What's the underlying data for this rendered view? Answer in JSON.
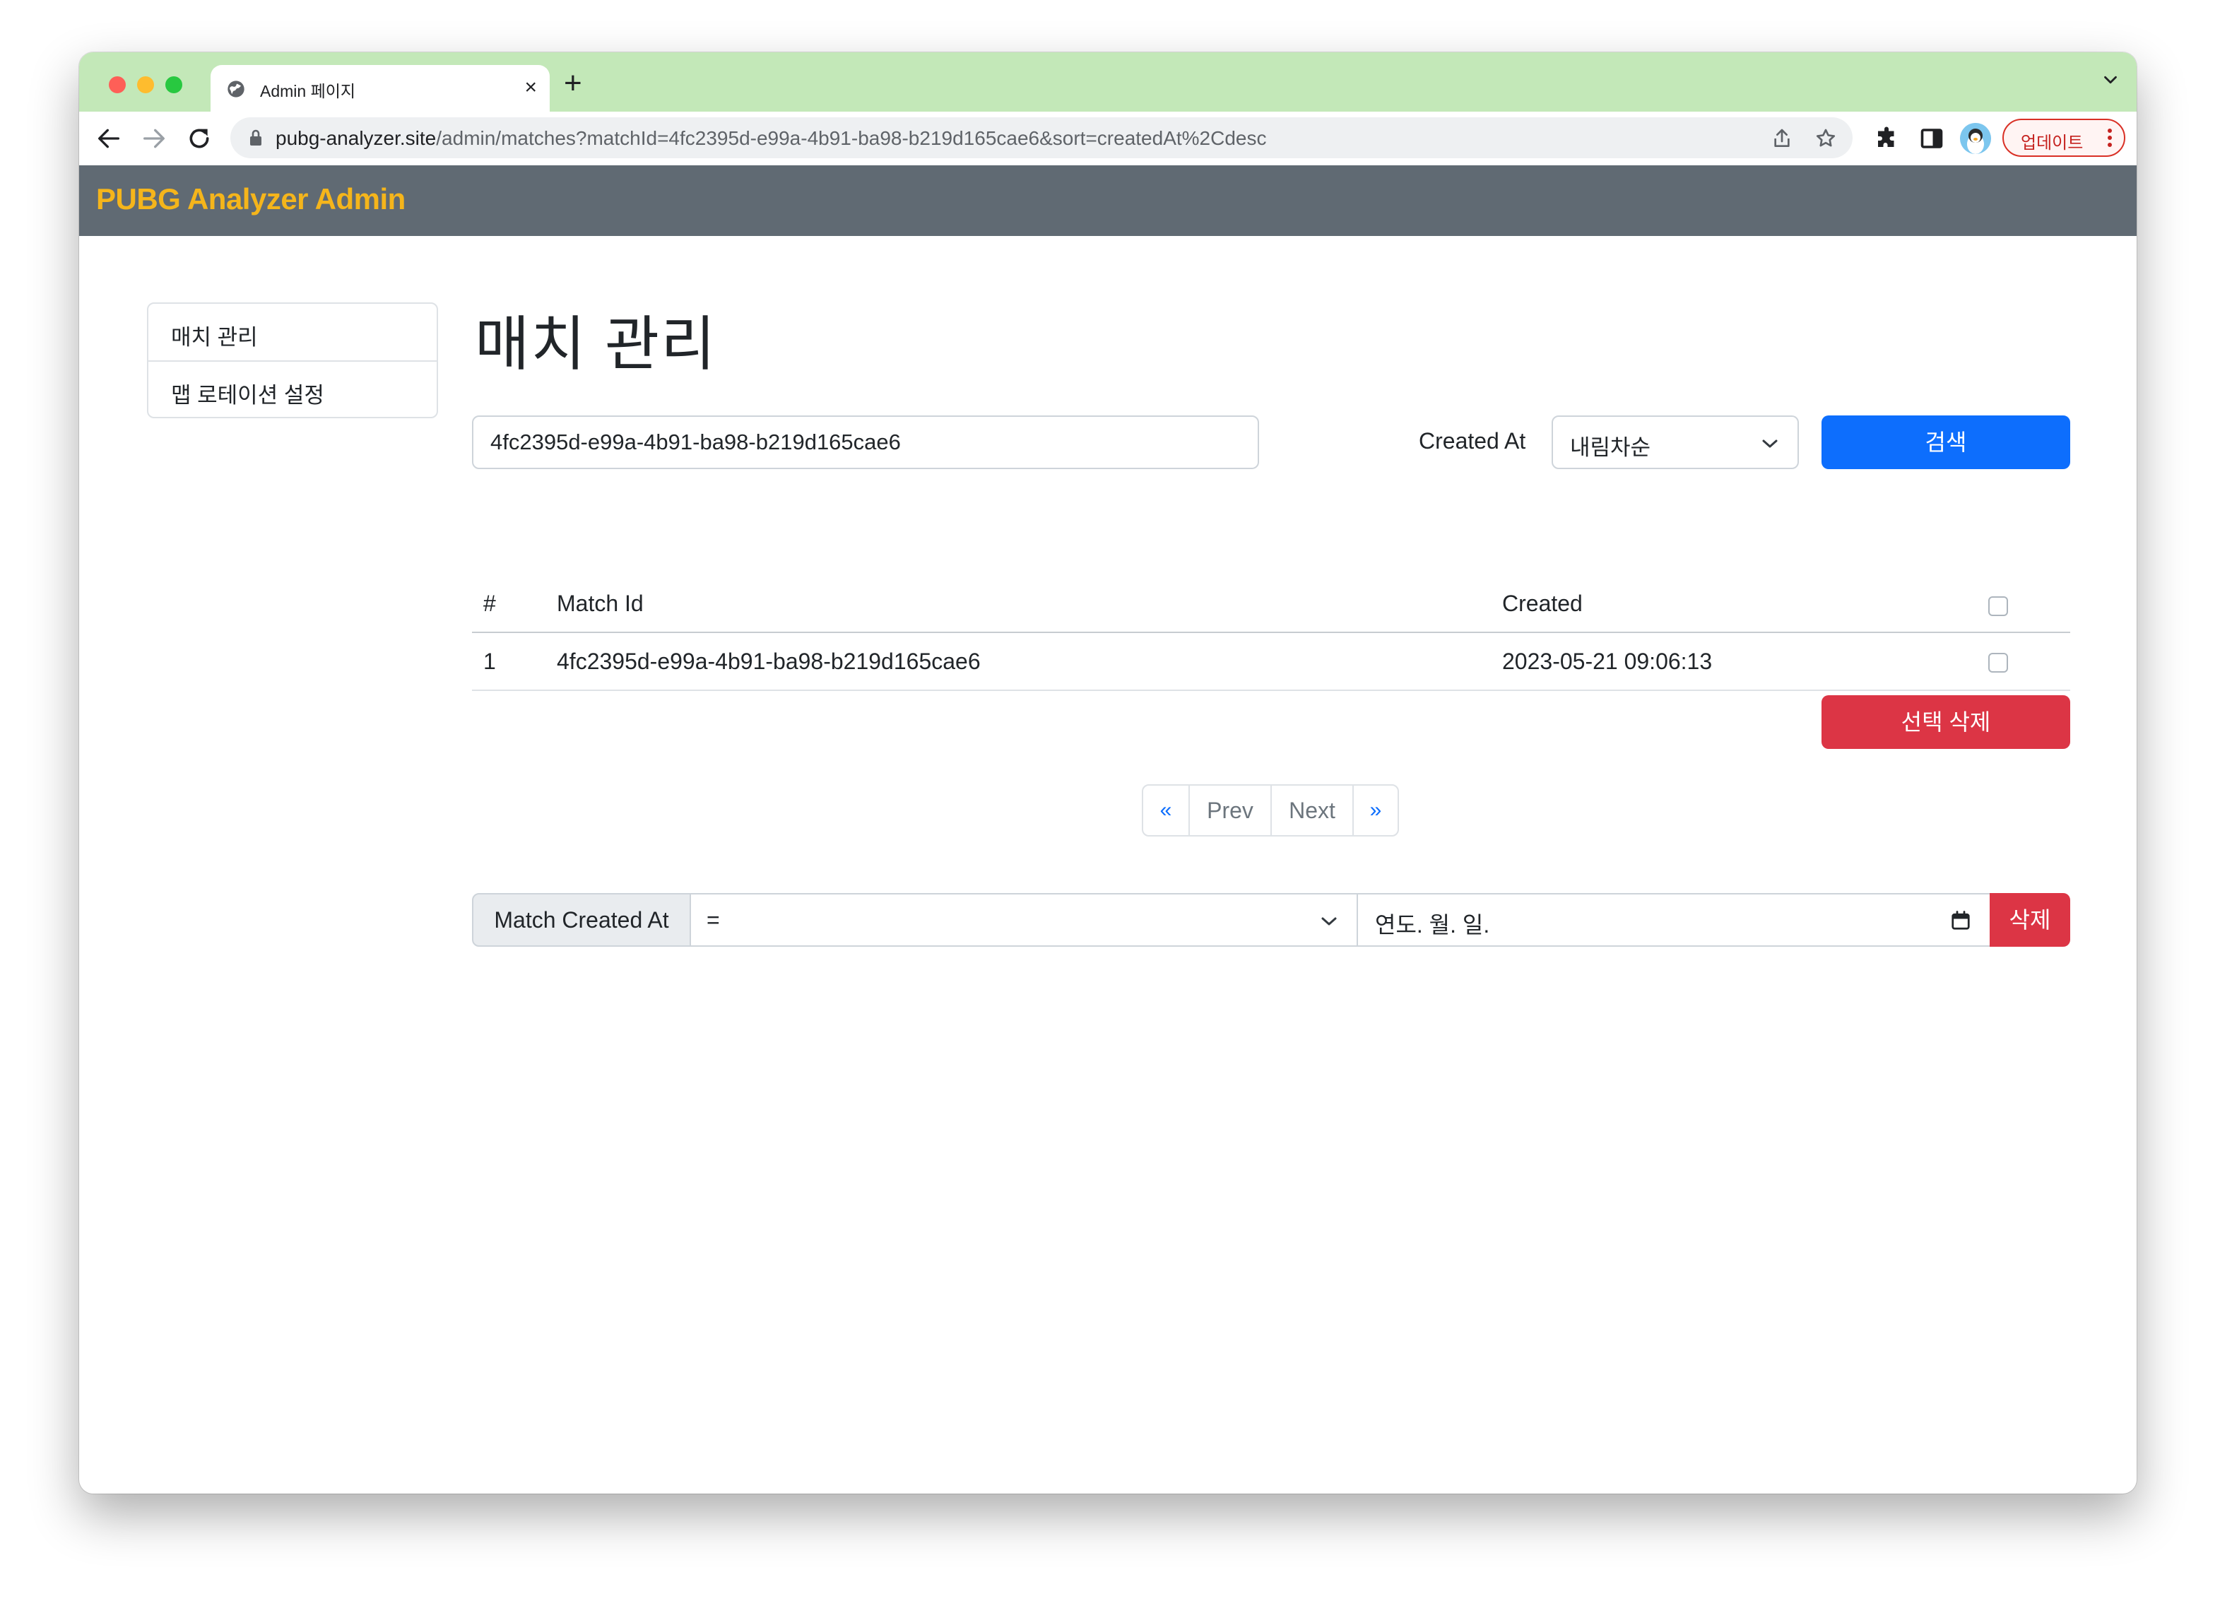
{
  "browser": {
    "tab_title": "Admin 페이지",
    "url_host": "pubg-analyzer.site",
    "url_path": "/admin/matches?matchId=4fc2395d-e99a-4b91-ba98-b219d165cae6&sort=createdAt%2Cdesc",
    "update_label": "업데이트",
    "new_tab_symbol": "+",
    "close_symbol": "×"
  },
  "navbar": {
    "brand": "PUBG Analyzer Admin"
  },
  "sidebar": {
    "items": [
      {
        "label": "매치 관리"
      },
      {
        "label": "맵 로테이션 설정"
      }
    ]
  },
  "main": {
    "title": "매치 관리",
    "search": {
      "value": "4fc2395d-e99a-4b91-ba98-b219d165cae6",
      "sort_label": "Created At",
      "sort_value": "내림차순",
      "button": "검색"
    },
    "table": {
      "headers": {
        "num": "#",
        "match_id": "Match Id",
        "created": "Created"
      },
      "rows": [
        {
          "num": "1",
          "match_id": "4fc2395d-e99a-4b91-ba98-b219d165cae6",
          "created": "2023-05-21 09:06:13"
        }
      ]
    },
    "delete_selected": "선택 삭제",
    "pagination": {
      "first": "«",
      "prev": "Prev",
      "next": "Next",
      "last": "»"
    },
    "filter": {
      "label": "Match Created At",
      "operator": "=",
      "date_placeholder": "연도. 월. 일.",
      "delete": "삭제"
    }
  },
  "colors": {
    "tab_strip": "#c3e8b8",
    "navbar": "#606a73",
    "brand": "#f5b51b",
    "primary": "#0d6efd",
    "danger": "#dc3545"
  }
}
